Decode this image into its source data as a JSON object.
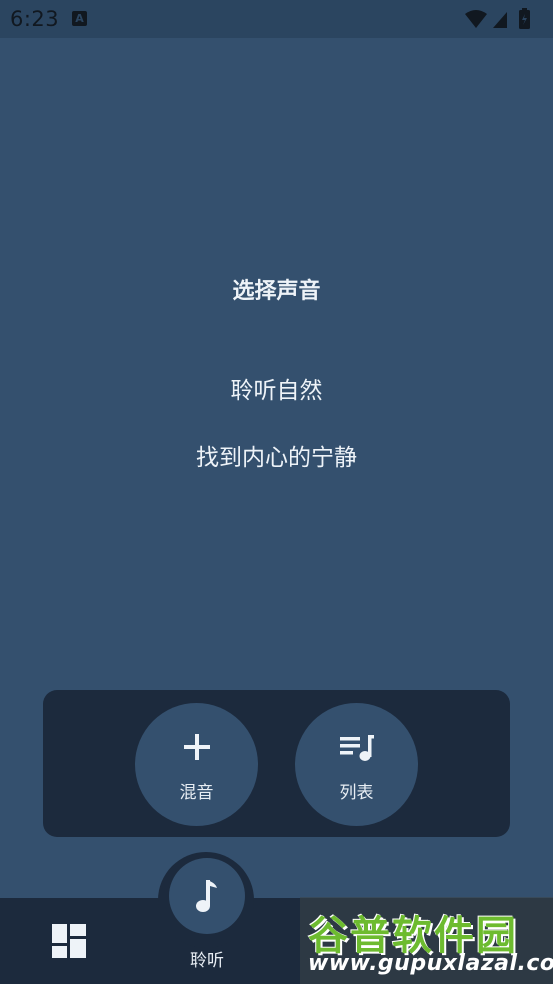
{
  "status_bar": {
    "time": "6:23",
    "notification_icon": "a-icon",
    "icons": [
      "wifi-icon",
      "signal-icon",
      "battery-icon"
    ]
  },
  "main": {
    "headline": "选择声音",
    "line1": "聆听自然",
    "line2": "找到内心的宁静"
  },
  "actions": {
    "mix_label": "混音",
    "mix_icon": "plus-icon",
    "list_label": "列表",
    "list_icon": "playlist-icon"
  },
  "bottom_nav": {
    "dashboard_icon": "dashboard-icon",
    "listen_icon": "music-note-icon",
    "listen_label": "聆听"
  },
  "watermark": {
    "logo_text": "谷普软件园",
    "url": "www.gupuxlazal.com"
  },
  "colors": {
    "background": "#34506e",
    "panel": "#1c2a3d",
    "text": "#e8eef4",
    "watermark_green": "#6dbb2f"
  }
}
